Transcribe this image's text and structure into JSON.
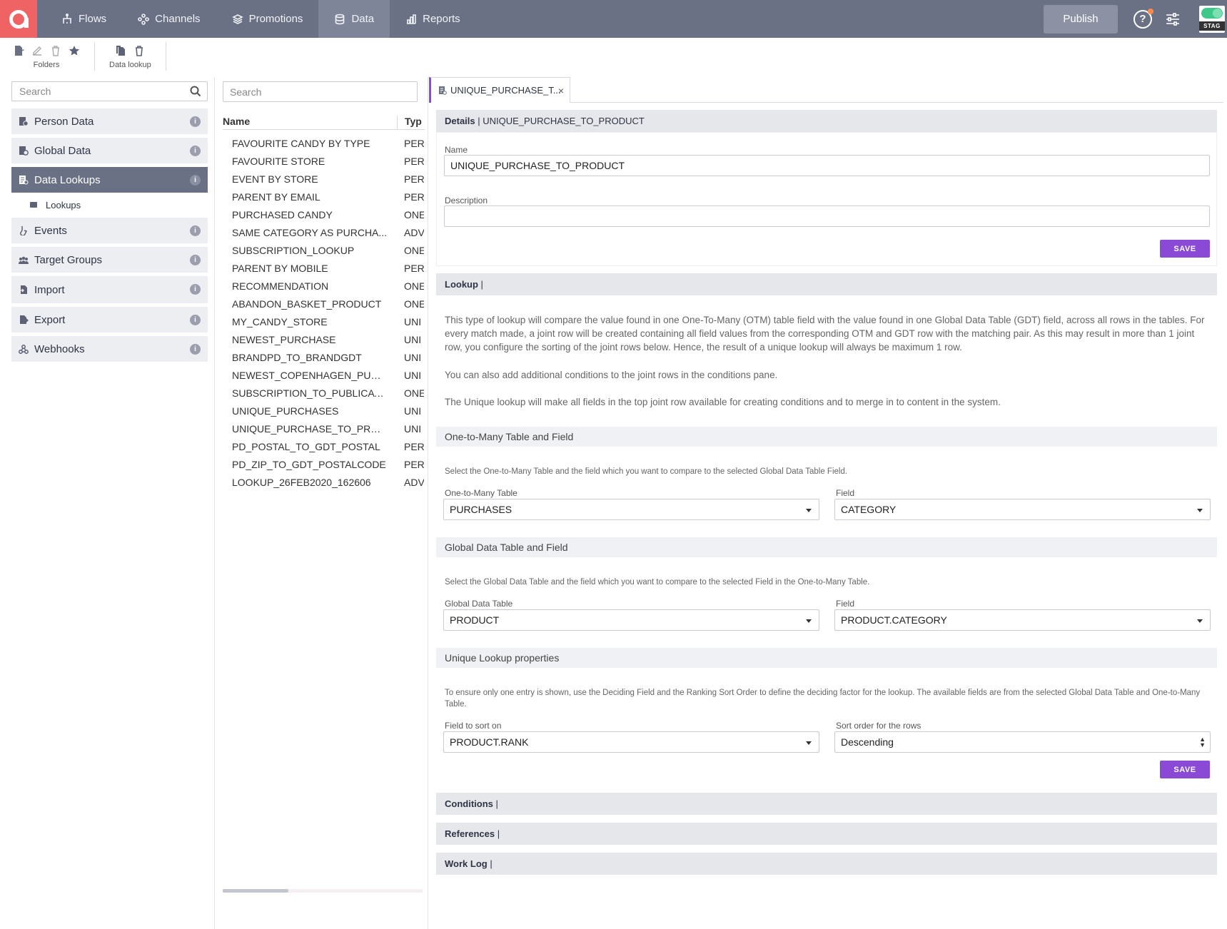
{
  "topbar": {
    "nav": [
      {
        "label": "Flows",
        "icon": "flows-icon"
      },
      {
        "label": "Channels",
        "icon": "channels-icon"
      },
      {
        "label": "Promotions",
        "icon": "promotions-icon"
      },
      {
        "label": "Data",
        "icon": "database-icon",
        "active": true
      },
      {
        "label": "Reports",
        "icon": "reports-icon"
      }
    ],
    "publish_label": "Publish",
    "help_label": "?",
    "env_label": "STAG"
  },
  "toolbar": {
    "folders_label": "Folders",
    "data_lookup_label": "Data lookup"
  },
  "sidebar": {
    "search_placeholder": "Search",
    "items": [
      {
        "label": "Person Data"
      },
      {
        "label": "Global Data"
      },
      {
        "label": "Data Lookups",
        "active": true
      },
      {
        "label": "Events"
      },
      {
        "label": "Target Groups"
      },
      {
        "label": "Import"
      },
      {
        "label": "Export"
      },
      {
        "label": "Webhooks"
      }
    ],
    "sub_item": "Lookups",
    "info_label": "i"
  },
  "list": {
    "search_placeholder": "Search",
    "col_name": "Name",
    "col_type": "Typ",
    "rows": [
      {
        "name": "FAVOURITE CANDY BY TYPE",
        "type": "PER"
      },
      {
        "name": "FAVOURITE STORE",
        "type": "PER"
      },
      {
        "name": "EVENT BY STORE",
        "type": "PER"
      },
      {
        "name": "PARENT BY EMAIL",
        "type": "PER"
      },
      {
        "name": "PURCHASED CANDY",
        "type": "ONE"
      },
      {
        "name": "SAME CATEGORY AS PURCHA...",
        "type": "ADV"
      },
      {
        "name": "SUBSCRIPTION_LOOKUP",
        "type": "ONE"
      },
      {
        "name": "PARENT BY MOBILE",
        "type": "PER"
      },
      {
        "name": "RECOMMENDATION",
        "type": "ONE"
      },
      {
        "name": "ABANDON_BASKET_PRODUCT",
        "type": "ONE"
      },
      {
        "name": "MY_CANDY_STORE",
        "type": "UNI"
      },
      {
        "name": "NEWEST_PURCHASE",
        "type": "UNI"
      },
      {
        "name": "BRANDPD_TO_BRANDGDT",
        "type": "UNI"
      },
      {
        "name": "NEWEST_COPENHAGEN_PURC...",
        "type": "UNI"
      },
      {
        "name": "SUBSCRIPTION_TO_PUBLICATI...",
        "type": "ONE"
      },
      {
        "name": "UNIQUE_PURCHASES",
        "type": "UNI"
      },
      {
        "name": "UNIQUE_PURCHASE_TO_PROD...",
        "type": "UNI"
      },
      {
        "name": "PD_POSTAL_TO_GDT_POSTAL",
        "type": "PER"
      },
      {
        "name": "PD_ZIP_TO_GDT_POSTALCODE",
        "type": "PER"
      },
      {
        "name": "LOOKUP_26FEB2020_162606",
        "type": "ADV"
      }
    ]
  },
  "detail": {
    "tab_label": "UNIQUE_PURCHASE_T...",
    "tab_close": "×",
    "details_title": "Details",
    "details_sep": " | ",
    "details_name": "UNIQUE_PURCHASE_TO_PRODUCT",
    "name_label": "Name",
    "name_value": "UNIQUE_PURCHASE_TO_PRODUCT",
    "description_label": "Description",
    "description_value": "",
    "save_label": "SAVE",
    "lookup_title": "Lookup",
    "lookup_sep": " |",
    "lookup_para1": "This type of lookup will compare the value found in one One-To-Many (OTM) table field with the value found in one Global Data Table (GDT) field, across all rows in the tables. For every match made, a joint row will be created containing all field values from the corresponding OTM and GDT row with the matching pair. As this may result in more than 1 joint row, you configure the sorting of the joint rows below. Hence, the result of a unique lookup will always be maximum 1 row.",
    "lookup_para2": "You can also add additional conditions to the joint rows in the conditions pane.",
    "lookup_para3": "The Unique lookup will make all fields in the top joint row available for creating conditions and to merge in to content in the system.",
    "otm_section": "One-to-Many Table and Field",
    "otm_help": "Select the One-to-Many Table and the field which you want to compare to the selected Global Data Table Field.",
    "otm_table_label": "One-to-Many Table",
    "otm_table_value": "PURCHASES",
    "otm_field_label": "Field",
    "otm_field_value": "CATEGORY",
    "gdt_section": "Global Data Table and Field",
    "gdt_help": "Select the Global Data Table and the field which you want to compare to the selected Field in the One-to-Many Table.",
    "gdt_table_label": "Global Data Table",
    "gdt_table_value": "PRODUCT",
    "gdt_field_label": "Field",
    "gdt_field_value": "PRODUCT.CATEGORY",
    "unique_section": "Unique Lookup properties",
    "unique_help": "To ensure only one entry is shown, use the Deciding Field and the Ranking Sort Order to define the deciding factor for the lookup. The available fields are from the selected Global Data Table and One-to-Many Table.",
    "sort_field_label": "Field to sort on",
    "sort_field_value": "PRODUCT.RANK",
    "sort_order_label": "Sort order for the rows",
    "sort_order_value": "Descending",
    "conditions_title": "Conditions",
    "references_title": "References",
    "worklog_title": "Work Log",
    "bar_sep": " |"
  }
}
